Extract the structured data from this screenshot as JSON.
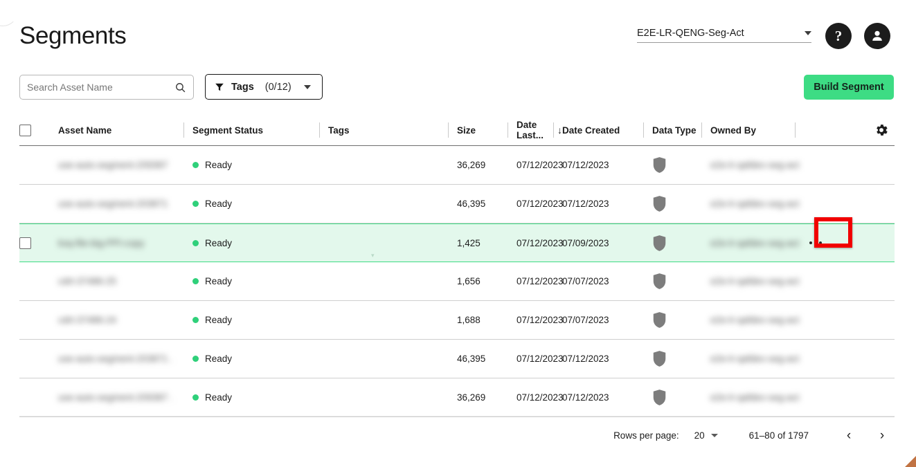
{
  "header": {
    "title": "Segments",
    "account_selector": {
      "value": "E2E-LR-QENG-Seg-Act",
      "icon": "chevron-down-icon"
    },
    "help_button": {
      "glyph": "?",
      "name": "help-icon"
    },
    "user_button": {
      "name": "account-circle-icon"
    }
  },
  "toolbar": {
    "search": {
      "placeholder": "Search Asset Name",
      "value": "",
      "icon": "search-icon"
    },
    "tags_filter": {
      "label": "Tags",
      "count": "(0/12)",
      "icon": "filter-icon",
      "caret": "chevron-down-icon"
    },
    "build_button": {
      "label": "Build Segment"
    }
  },
  "table": {
    "select_all_checkbox": {
      "checked": false
    },
    "settings_icon": "gear-icon",
    "columns": [
      {
        "key": "asset_name",
        "label": "Asset Name"
      },
      {
        "key": "segment_status",
        "label": "Segment Status"
      },
      {
        "key": "tags",
        "label": "Tags"
      },
      {
        "key": "size",
        "label": "Size"
      },
      {
        "key": "date_last",
        "label": "Date Last...",
        "sorted": "desc",
        "sort_icon": "arrow-down-icon"
      },
      {
        "key": "date_created",
        "label": "Date Created"
      },
      {
        "key": "data_type",
        "label": "Data Type"
      },
      {
        "key": "owned_by",
        "label": "Owned By"
      }
    ],
    "rows": [
      {
        "asset_name": "use-auto-segment-209387",
        "status": "Ready",
        "tags": "",
        "size": "36,269",
        "date_last": "07/12/2023",
        "date_created": "07/12/2023",
        "data_type_icon": "shield-icon",
        "owned_by": "e2e-lr-qafdev-seg-act",
        "selected": false,
        "checkbox_visible": false
      },
      {
        "asset_name": "use-auto-segment-203871",
        "status": "Ready",
        "tags": "",
        "size": "46,395",
        "date_last": "07/12/2023",
        "date_created": "07/12/2023",
        "data_type_icon": "shield-icon",
        "owned_by": "e2e-lr-qafdev-seg-act",
        "selected": false,
        "checkbox_visible": false
      },
      {
        "asset_name": "ksq-file-big-PPI-copy",
        "status": "Ready",
        "tags": "",
        "size": "1,425",
        "date_last": "07/12/2023",
        "date_created": "07/09/2023",
        "data_type_icon": "shield-icon",
        "owned_by": "e2e-lr-qafdev-seg-act",
        "selected": true,
        "checkbox_visible": true
      },
      {
        "asset_name": "cdrt-37486-25",
        "status": "Ready",
        "tags": "",
        "size": "1,656",
        "date_last": "07/12/2023",
        "date_created": "07/07/2023",
        "data_type_icon": "shield-icon",
        "owned_by": "e2e-lr-qafdev-seg-act",
        "selected": false,
        "checkbox_visible": false
      },
      {
        "asset_name": "cdrt-37486-24",
        "status": "Ready",
        "tags": "",
        "size": "1,688",
        "date_last": "07/12/2023",
        "date_created": "07/07/2023",
        "data_type_icon": "shield-icon",
        "owned_by": "e2e-lr-qafdev-seg-act",
        "selected": false,
        "checkbox_visible": false
      },
      {
        "asset_name": "use-auto-segment-203871 .",
        "status": "Ready",
        "tags": "",
        "size": "46,395",
        "date_last": "07/12/2023",
        "date_created": "07/12/2023",
        "data_type_icon": "shield-icon",
        "owned_by": "e2e-lr-qafdev-seg-act",
        "selected": false,
        "checkbox_visible": false
      },
      {
        "asset_name": "use-auto-segment-209387 .",
        "status": "Ready",
        "tags": "",
        "size": "36,269",
        "date_last": "07/12/2023",
        "date_created": "07/12/2023",
        "data_type_icon": "shield-icon",
        "owned_by": "e2e-lr-qafdev-seg-act",
        "selected": false,
        "checkbox_visible": false
      }
    ],
    "row_action": {
      "icon": "more-options-icon",
      "highlighted": true,
      "highlight_color": "#f10000"
    }
  },
  "footer": {
    "rows_per_page_label": "Rows per page:",
    "rows_per_page_value": "20",
    "range_text": "61–80 of 1797",
    "prev_button": {
      "glyph": "‹",
      "name": "previous-page-icon"
    },
    "next_button": {
      "glyph": "›",
      "name": "next-page-icon"
    }
  },
  "colors": {
    "accent_green": "#3ddc84",
    "status_green": "#2fd07a",
    "selected_row_bg": "#e3f8ec",
    "highlight_red": "#f10000",
    "shield_gray": "#7d7d7d"
  }
}
